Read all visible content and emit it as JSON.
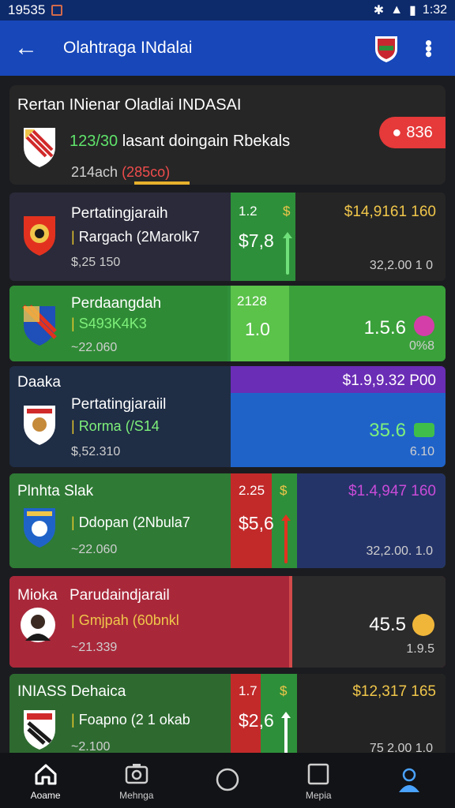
{
  "status": {
    "time_left": "19535",
    "time_right": "1:32"
  },
  "appbar": {
    "title": "Olahtraga INdalai"
  },
  "hero": {
    "title": "Rertan INienar  Oladlai INDASAI",
    "line1_num": "123/30",
    "line1_text": " lasant doingain Rbekals",
    "line2_a": "214ach ",
    "line2_b": "(285co)",
    "badge": "836"
  },
  "cards": [
    {
      "title": "Pertatingjaraih",
      "line2": "Rargach (2Marolk7",
      "sub": "$,25 150",
      "score_small": "1.2",
      "score_sym": "$",
      "score_big": "$7,8",
      "money": "$14,9161 160",
      "right_small": "32,2.00   1 0"
    },
    {
      "title": "Perdaangdah",
      "line2": "S493K4K3",
      "sub": "22.060",
      "score_small": "2128",
      "score_big": "1.0",
      "right_big": "1.5.6",
      "right_small": "0%8"
    },
    {
      "top_label": "Daaka",
      "title": "Pertatingjaraiil",
      "line2": "Rorma (/S14",
      "sub": "$,52.310",
      "money": "$1.9,9.32 P00",
      "right_big": "35.6",
      "right_small": "6.10"
    },
    {
      "top_label": "Plnhta Slak",
      "line2": "Ddopan (2Nbula7",
      "sub": "22.060",
      "score_small": "2.25",
      "score_sym": "$",
      "score_big": "$5,6",
      "money": "$1.4,947 160",
      "right_small": "32,2.00.  1.0"
    },
    {
      "top_label": "Mioka",
      "title": "Parudaindjarail",
      "line2": "Gmjpah (60bnkl",
      "sub": "21.339",
      "right_big": "45.5",
      "right_small": "1.9.5"
    },
    {
      "top_label": "INIASS  Dehaica",
      "line2": "Foapno (2 1 okab",
      "sub": "2.100",
      "score_small": "1.7",
      "score_sym": "$",
      "score_big": "$2,6",
      "money": "$12,317 165",
      "right_small": "75 2.00   1.0"
    }
  ],
  "nav": [
    {
      "label": "Aoame"
    },
    {
      "label": "Mehnga"
    },
    {
      "label": ""
    },
    {
      "label": "Mepia"
    },
    {
      "label": ""
    }
  ],
  "colors": {
    "appbar": "#1747b9",
    "green": "#2f8f3a",
    "red": "#b0283a",
    "purple": "#6a2db5",
    "blue": "#1f63c9",
    "gold": "#f0c64a"
  }
}
